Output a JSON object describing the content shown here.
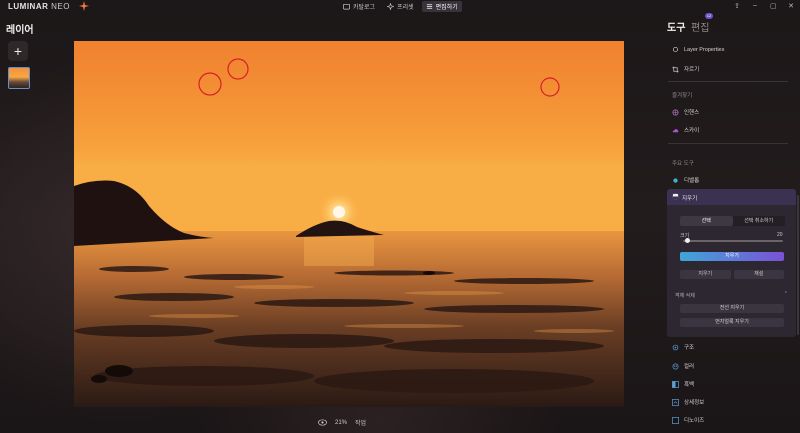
{
  "app": {
    "logo_main": "LUMINAR",
    "logo_sub": "NEO"
  },
  "nav": {
    "items": [
      {
        "label": "카탈로그",
        "icon": "folder-icon"
      },
      {
        "label": "프리셋",
        "icon": "presets-icon"
      },
      {
        "label": "편집하기",
        "icon": "edit-icon",
        "active": true
      }
    ]
  },
  "window_controls": [
    "share-icon",
    "minimize-icon",
    "maximize-icon",
    "close-icon"
  ],
  "left_panel": {
    "title": "레이어",
    "add_label": "+"
  },
  "canvas": {
    "zoom": "21%",
    "action_label": "작업"
  },
  "right_panel": {
    "tab_tools": "도구",
    "tab_edits": "편집",
    "edits_badge": "12",
    "layer_properties": "Layer Properties",
    "crop": "자르기",
    "favorites_header": "즐겨찾기",
    "enhance": "인핸스",
    "sky": "스카이",
    "main_tools_header": "주요 도구",
    "develop": "디벨롭",
    "eraser": {
      "title": "지우기",
      "seg_select": "선택",
      "seg_deselect": "선택 취소하기",
      "size_label": "크기",
      "size_value": "20",
      "erase_button": "지우기",
      "clear_button": "지우기",
      "reset_button": "재설",
      "object_removal_label": "객체 삭제",
      "wire_removal": "전선 지우기",
      "dust_removal": "먼지얼룩 지우기"
    },
    "structure": "구조",
    "color": "컬러",
    "bw": "흑백",
    "details": "상세정보",
    "noise": "디노이즈"
  },
  "colors": {
    "accent_gradient_start": "#3fa6d8",
    "accent_gradient_end": "#7a52d6",
    "selection_circle": "#d81f28"
  }
}
